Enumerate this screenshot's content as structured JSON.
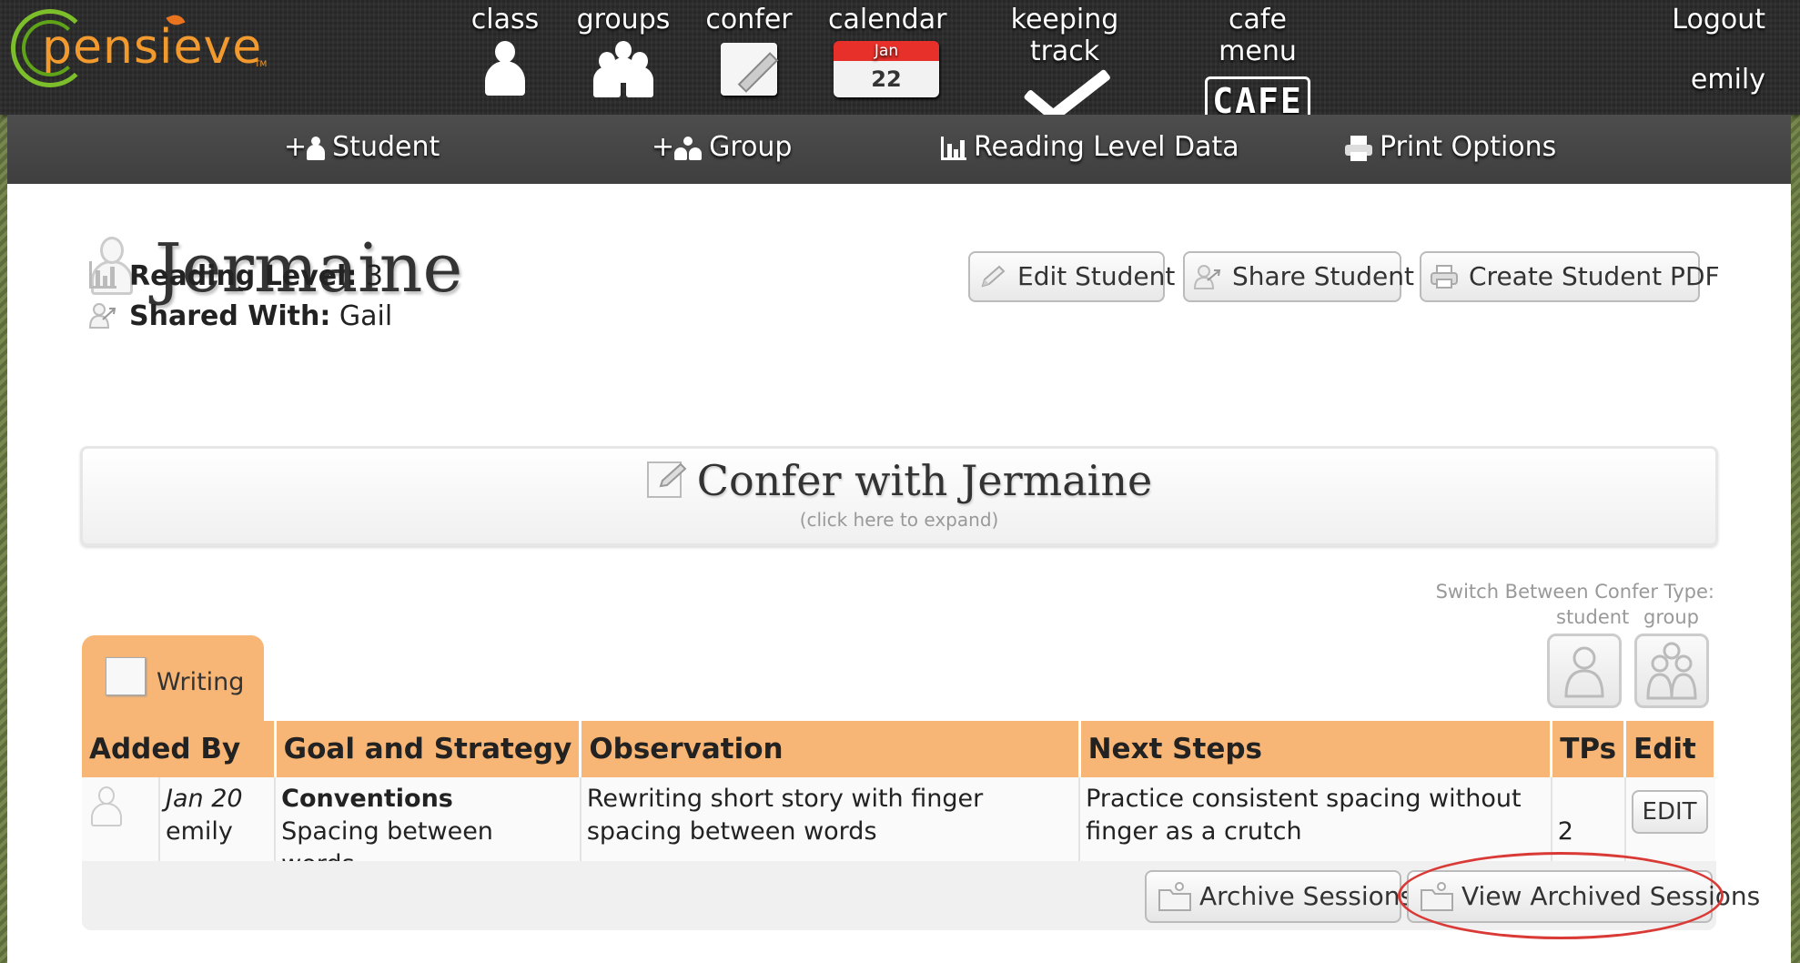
{
  "topnav": {
    "logo_text": "pensieve",
    "items": [
      {
        "label": "class",
        "icon": "person-icon"
      },
      {
        "label": "groups",
        "icon": "group-icon"
      },
      {
        "label": "confer",
        "icon": "notepad-pencil-icon"
      },
      {
        "label": "calendar",
        "icon": "calendar-icon",
        "month": "Jan",
        "day": "22"
      },
      {
        "label": "keeping track",
        "icon": "checkmark-icon"
      },
      {
        "label": "cafe menu",
        "icon": "cafe-icon",
        "icon_text": "CAFE"
      }
    ],
    "logout": "Logout",
    "username": "emily"
  },
  "subnav": {
    "items": [
      {
        "label": "Student",
        "prefix": "+"
      },
      {
        "label": "Group",
        "prefix": "+"
      },
      {
        "label": "Reading Level Data"
      },
      {
        "label": "Print Options"
      }
    ]
  },
  "student": {
    "name": "Jermaine",
    "reading_level_label": "Reading Level:",
    "reading_level_value": "3",
    "shared_with_label": "Shared With:",
    "shared_with_value": "Gail"
  },
  "actions": {
    "edit": "Edit Student",
    "share": "Share Student",
    "pdf": "Create Student PDF"
  },
  "confer_panel": {
    "title": "Confer with Jermaine",
    "subtitle": "(click here to expand)"
  },
  "switch": {
    "label": "Switch Between Confer Type:",
    "student": "student",
    "group": "group"
  },
  "tab": {
    "label": "Writing"
  },
  "table": {
    "headers": [
      "Added By",
      "Goal and Strategy",
      "Observation",
      "Next Steps",
      "TPs",
      "Edit"
    ],
    "rows": [
      {
        "date": "Jan 20",
        "author": "emily",
        "goal": "Conventions",
        "strategy": "Spacing between words",
        "observation": "Rewriting short story with finger spacing between words",
        "next_steps": "Practice consistent spacing without finger as a crutch",
        "tps": "2",
        "edit": "EDIT"
      }
    ]
  },
  "footer": {
    "archive": "Archive Sessions",
    "view_archived": "View Archived Sessions"
  },
  "colors": {
    "accent_orange": "#f8b676",
    "highlight_red": "#d93a36",
    "logo_green": "#7cbf2a",
    "logo_orange": "#f29a2e"
  }
}
